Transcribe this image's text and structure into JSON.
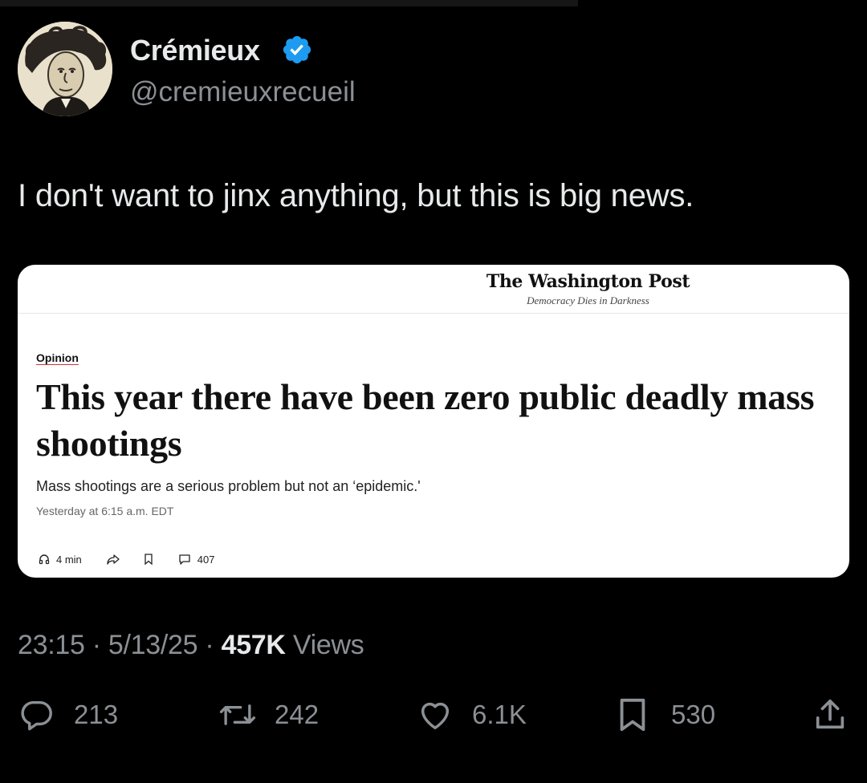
{
  "author": {
    "display_name": "Crémieux",
    "handle": "@cremieuxrecueil",
    "avatar_icon": "caricature-portrait-avatar",
    "verified_color": "#1d9bf0"
  },
  "tweet": {
    "text": "I don't want to jinx anything, but this is big news."
  },
  "article_card": {
    "publication": "The Washington Post",
    "tagline": "Democracy Dies in Darkness",
    "section": "Opinion",
    "headline": "This year there have been zero public deadly mass shootings",
    "dek": "Mass shootings are a serious problem but not an ‘epidemic.'",
    "timestamp": "Yesterday at 6:15 a.m. EDT",
    "read_time": "4 min",
    "comments": "407",
    "icons": [
      "headphones-icon",
      "share-icon",
      "bookmark-icon",
      "comment-icon"
    ]
  },
  "meta": {
    "time": "23:15",
    "date": "5/13/25",
    "views_count": "457K",
    "views_label": "Views"
  },
  "engagement": {
    "replies": "213",
    "reposts": "242",
    "likes": "6.1K",
    "bookmarks": "530",
    "icons": [
      "reply-icon",
      "repost-icon",
      "like-icon",
      "bookmark-icon",
      "share-icon"
    ]
  }
}
